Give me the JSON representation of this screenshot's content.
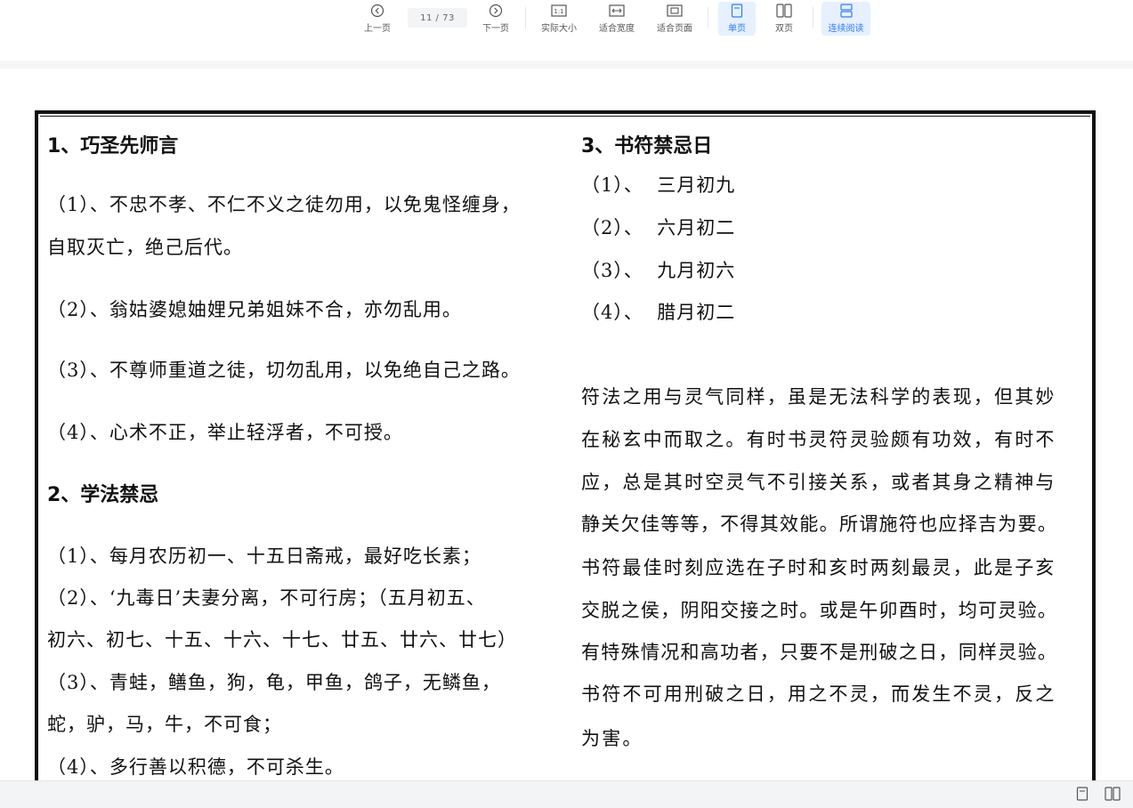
{
  "toolbar": {
    "prev": "上一页",
    "page_indicator": "11 / 73",
    "next": "下一页",
    "actual_size": "实际大小",
    "fit_width": "适合宽度",
    "fit_page": "适合页面",
    "single_page": "单页",
    "double_page": "双页",
    "continuous": "连续阅读",
    "actual_size_glyph": "1:1",
    "accent": "#2f7cf6"
  },
  "document": {
    "left": {
      "h1": "1、巧圣先师言",
      "p1a": "（1）、不忠不孝、不仁不义之徒勿用，以免鬼怪缠身，",
      "p1b": "自取灭亡，绝己后代。",
      "p2": "（2）、翁姑婆媳妯娌兄弟姐妹不合，亦勿乱用。",
      "p3": "（3）、不尊师重道之徒，切勿乱用，以免绝自己之路。",
      "p4": "（4）、心术不正，举止轻浮者，不可授。",
      "h2": "2、学法禁忌",
      "q1": "（1）、每月农历初一、十五日斋戒，最好吃长素；",
      "q2a": "（2）、‘九毒日’夫妻分离，不可行房；（五月初五、",
      "q2b": "初六、初七、十五、十六、十七、廿五、廿六、廿七）",
      "q3a": "（3）、青蛙，鳝鱼，狗，龟，甲鱼，鸽子，无鳞鱼，",
      "q3b": "蛇，驴，马，牛，不可食；",
      "q4": "（4）、多行善以积德，不可杀生。"
    },
    "right": {
      "h3": "3、书符禁忌日",
      "d1": "（1）、  三月初九",
      "d2": "（2）、  六月初二",
      "d3": "（3）、  九月初六",
      "d4": "（4）、  腊月初二",
      "l1": "符法之用与灵气同样，虽是无法科学的表现，但其妙",
      "l2": "在秘玄中而取之。有时书灵符灵验颇有功效，有时不",
      "l3": "应，总是其时空灵气不引接关系，或者其身之精神与",
      "l4": "静关欠佳等等，不得其效能。所谓施符也应择吉为要。",
      "l5": "书符最佳时刻应选在子时和亥时两刻最灵，此是子亥",
      "l6": "交脱之侯，阴阳交接之时。或是午卯酉时，均可灵验。",
      "l7": "有特殊情况和高功者，只要不是刑破之日，同样灵验。",
      "l8": "书符不可用刑破之日，用之不灵，而发生不灵，反之",
      "l9": "为害。"
    }
  }
}
